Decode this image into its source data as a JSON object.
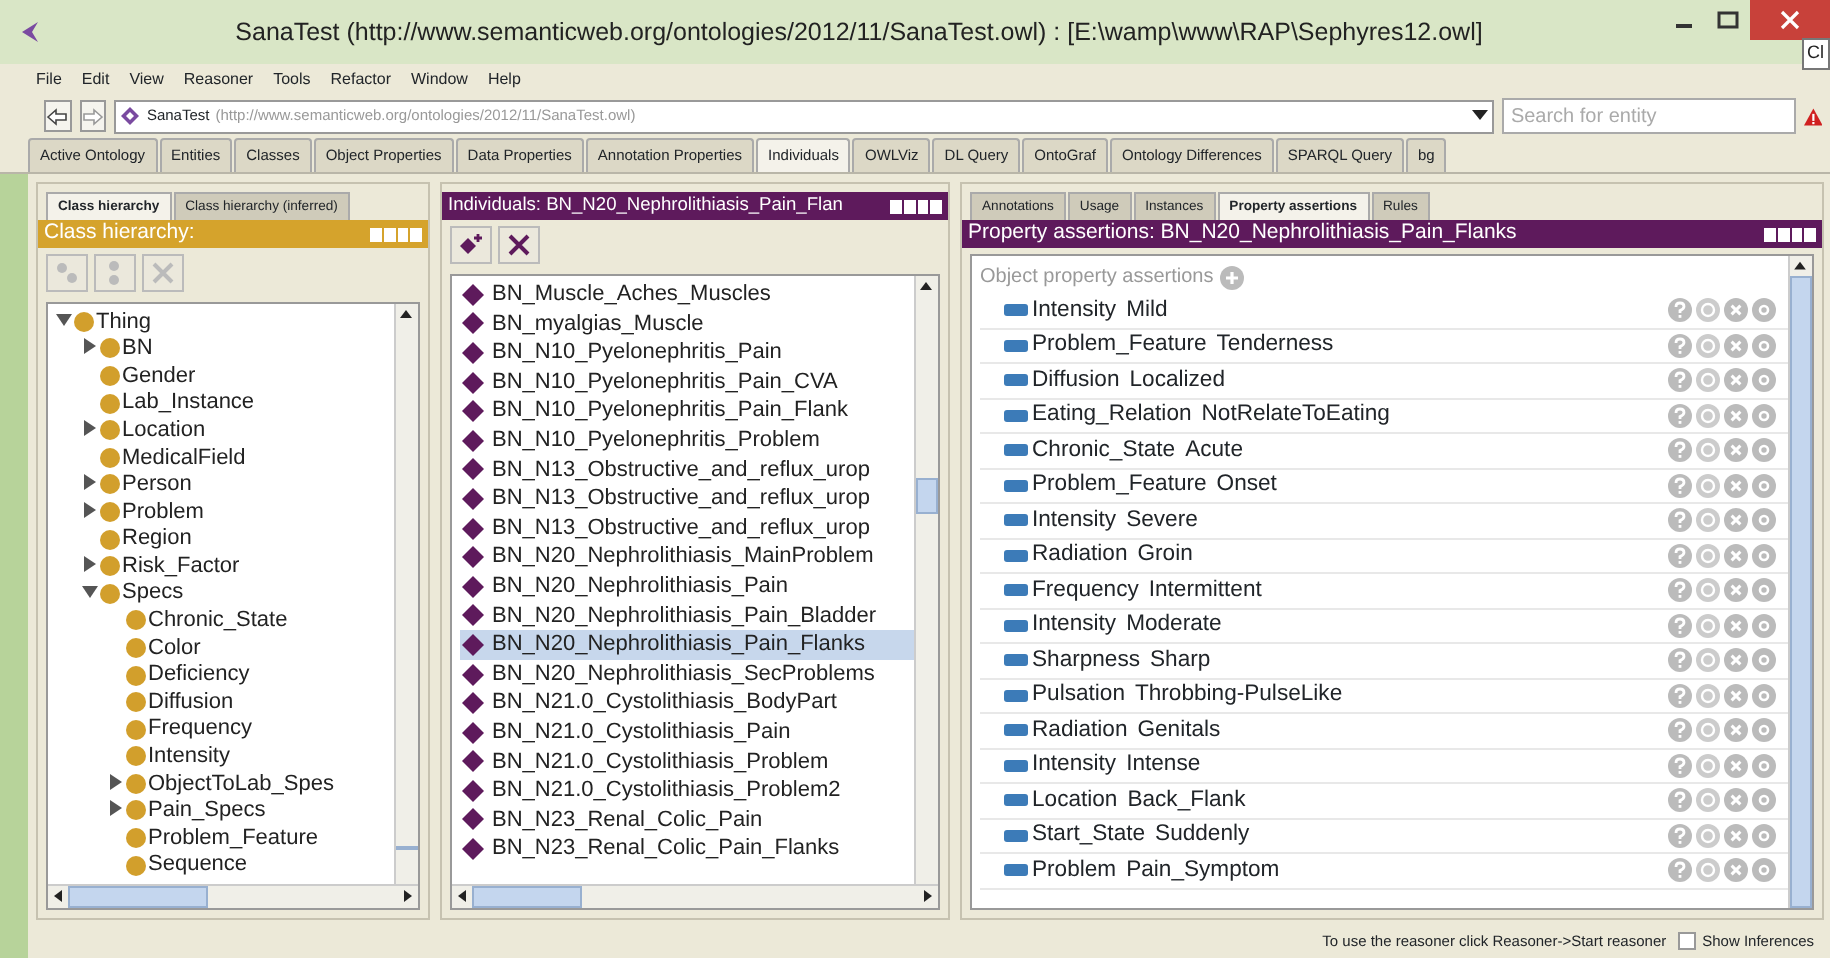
{
  "window": {
    "title": "SanaTest (http://www.semanticweb.org/ontologies/2012/11/SanaTest.owl)  : [E:\\wamp\\www\\RAP\\Sephyres12.owl]",
    "tooltip": "Cl"
  },
  "menu": [
    "File",
    "Edit",
    "View",
    "Reasoner",
    "Tools",
    "Refactor",
    "Window",
    "Help"
  ],
  "address": {
    "ontology": "SanaTest",
    "iri": "(http://www.semanticweb.org/ontologies/2012/11/SanaTest.owl)",
    "search_placeholder": "Search for entity"
  },
  "tabs": [
    {
      "label": "Active Ontology",
      "selected": false
    },
    {
      "label": "Entities",
      "selected": false
    },
    {
      "label": "Classes",
      "selected": false
    },
    {
      "label": "Object Properties",
      "selected": false
    },
    {
      "label": "Data Properties",
      "selected": false
    },
    {
      "label": "Annotation Properties",
      "selected": false
    },
    {
      "label": "Individuals",
      "selected": true
    },
    {
      "label": "OWLViz",
      "selected": false
    },
    {
      "label": "DL Query",
      "selected": false
    },
    {
      "label": "OntoGraf",
      "selected": false
    },
    {
      "label": "Ontology Differences",
      "selected": false
    },
    {
      "label": "SPARQL Query",
      "selected": false
    },
    {
      "label": "bg",
      "selected": false
    }
  ],
  "class_panel": {
    "tabs": [
      {
        "label": "Class hierarchy",
        "selected": true
      },
      {
        "label": "Class hierarchy (inferred)",
        "selected": false
      }
    ],
    "header": "Class hierarchy:",
    "tree": [
      {
        "label": "Thing",
        "expanded": true,
        "children": [
          {
            "label": "BN",
            "expanded": false
          },
          {
            "label": "Gender"
          },
          {
            "label": "Lab_Instance"
          },
          {
            "label": "Location",
            "expanded": false
          },
          {
            "label": "MedicalField"
          },
          {
            "label": "Person",
            "expanded": false
          },
          {
            "label": "Problem",
            "expanded": false
          },
          {
            "label": "Region"
          },
          {
            "label": "Risk_Factor",
            "expanded": false
          },
          {
            "label": "Specs",
            "expanded": true,
            "children": [
              {
                "label": "Chronic_State"
              },
              {
                "label": "Color"
              },
              {
                "label": "Deficiency"
              },
              {
                "label": "Diffusion"
              },
              {
                "label": "Frequency"
              },
              {
                "label": "Intensity"
              },
              {
                "label": "ObjectToLab_Spes",
                "expanded": false
              },
              {
                "label": "Pain_Specs",
                "expanded": false
              },
              {
                "label": "Problem_Feature"
              },
              {
                "label": "Sequence"
              }
            ]
          }
        ]
      }
    ]
  },
  "individuals_panel": {
    "header": "Individuals: BN_N20_Nephrolithiasis_Pain_Flan",
    "items": [
      {
        "label": "BN_Muscle_Aches_Muscles",
        "selected": false
      },
      {
        "label": "BN_myalgias_Muscle",
        "selected": false
      },
      {
        "label": "BN_N10_Pyelonephritis_Pain",
        "selected": false
      },
      {
        "label": "BN_N10_Pyelonephritis_Pain_CVA",
        "selected": false
      },
      {
        "label": "BN_N10_Pyelonephritis_Pain_Flank",
        "selected": false
      },
      {
        "label": "BN_N10_Pyelonephritis_Problem",
        "selected": false
      },
      {
        "label": "BN_N13_Obstructive_and_reflux_urop",
        "selected": false
      },
      {
        "label": "BN_N13_Obstructive_and_reflux_urop",
        "selected": false
      },
      {
        "label": "BN_N13_Obstructive_and_reflux_urop",
        "selected": false
      },
      {
        "label": "BN_N20_Nephrolithiasis_MainProblem",
        "selected": false
      },
      {
        "label": "BN_N20_Nephrolithiasis_Pain",
        "selected": false
      },
      {
        "label": "BN_N20_Nephrolithiasis_Pain_Bladder",
        "selected": false
      },
      {
        "label": "BN_N20_Nephrolithiasis_Pain_Flanks",
        "selected": true
      },
      {
        "label": "BN_N20_Nephrolithiasis_SecProblems",
        "selected": false
      },
      {
        "label": "BN_N21.0_Cystolithiasis_BodyPart",
        "selected": false
      },
      {
        "label": "BN_N21.0_Cystolithiasis_Pain",
        "selected": false
      },
      {
        "label": "BN_N21.0_Cystolithiasis_Problem",
        "selected": false
      },
      {
        "label": "BN_N21.0_Cystolithiasis_Problem2",
        "selected": false
      },
      {
        "label": "BN_N23_Renal_Colic_Pain",
        "selected": false
      },
      {
        "label": "BN_N23_Renal_Colic_Pain_Flanks",
        "selected": false
      }
    ]
  },
  "assertions_panel": {
    "tabs": [
      {
        "label": "Annotations",
        "selected": false
      },
      {
        "label": "Usage",
        "selected": false
      },
      {
        "label": "Instances",
        "selected": false
      },
      {
        "label": "Property assertions",
        "selected": true
      },
      {
        "label": "Rules",
        "selected": false
      }
    ],
    "header": "Property assertions: BN_N20_Nephrolithiasis_Pain_Flanks",
    "section": "Object property assertions",
    "rows": [
      {
        "property": "Intensity",
        "value": "Mild"
      },
      {
        "property": "Problem_Feature",
        "value": "Tenderness"
      },
      {
        "property": "Diffusion",
        "value": "Localized"
      },
      {
        "property": "Eating_Relation",
        "value": "NotRelateToEating"
      },
      {
        "property": "Chronic_State",
        "value": "Acute"
      },
      {
        "property": "Problem_Feature",
        "value": "Onset"
      },
      {
        "property": "Intensity",
        "value": "Severe"
      },
      {
        "property": "Radiation",
        "value": "Groin"
      },
      {
        "property": "Frequency",
        "value": "Intermittent"
      },
      {
        "property": "Intensity",
        "value": "Moderate"
      },
      {
        "property": "Sharpness",
        "value": "Sharp"
      },
      {
        "property": "Pulsation",
        "value": "Throbbing-PulseLike"
      },
      {
        "property": "Radiation",
        "value": "Genitals"
      },
      {
        "property": "Intensity",
        "value": "Intense"
      },
      {
        "property": "Location",
        "value": "Back_Flank"
      },
      {
        "property": "Start_State",
        "value": "Suddenly"
      },
      {
        "property": "Problem",
        "value": "Pain_Symptom"
      }
    ]
  },
  "status_bar": {
    "message": "To use the reasoner click Reasoner->Start reasoner",
    "show_inferences": {
      "label": "Show Inferences",
      "checked": false
    }
  }
}
